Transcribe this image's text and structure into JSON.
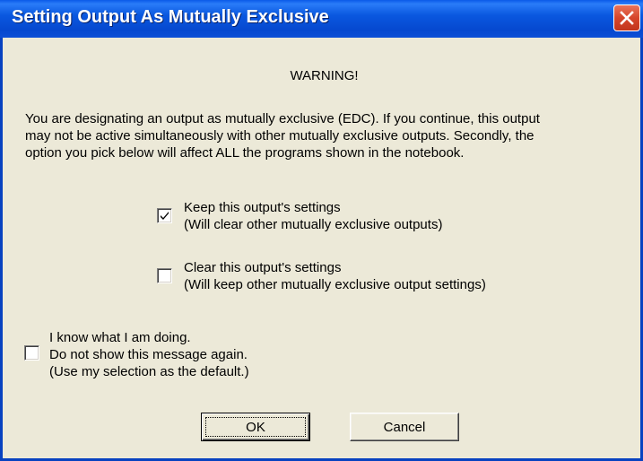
{
  "window": {
    "title": "Setting Output As Mutually Exclusive"
  },
  "warning": {
    "heading": "WARNING!",
    "lines": [
      "You are designating an output as mutually exclusive (EDC).  If you continue, this output",
      "may not be active simultaneously with other mutually exclusive outputs.  Secondly, the",
      "option you pick below will affect ALL the programs shown in the notebook."
    ]
  },
  "options": [
    {
      "line1": "Keep this output's settings",
      "line2": "(Will clear other mutually exclusive outputs)",
      "checked": true
    },
    {
      "line1": "Clear this output's settings",
      "line2": "(Will keep other mutually exclusive output settings)",
      "checked": false
    }
  ],
  "dont_show": {
    "line1": "I know what I am doing.",
    "line2": "Do not show this message again.",
    "line3": "(Use my selection as the default.)",
    "checked": false
  },
  "buttons": {
    "ok": "OK",
    "cancel": "Cancel"
  },
  "colors": {
    "titlebar": "#0a58e0",
    "face": "#ece9d8",
    "close": "#d6452a"
  }
}
